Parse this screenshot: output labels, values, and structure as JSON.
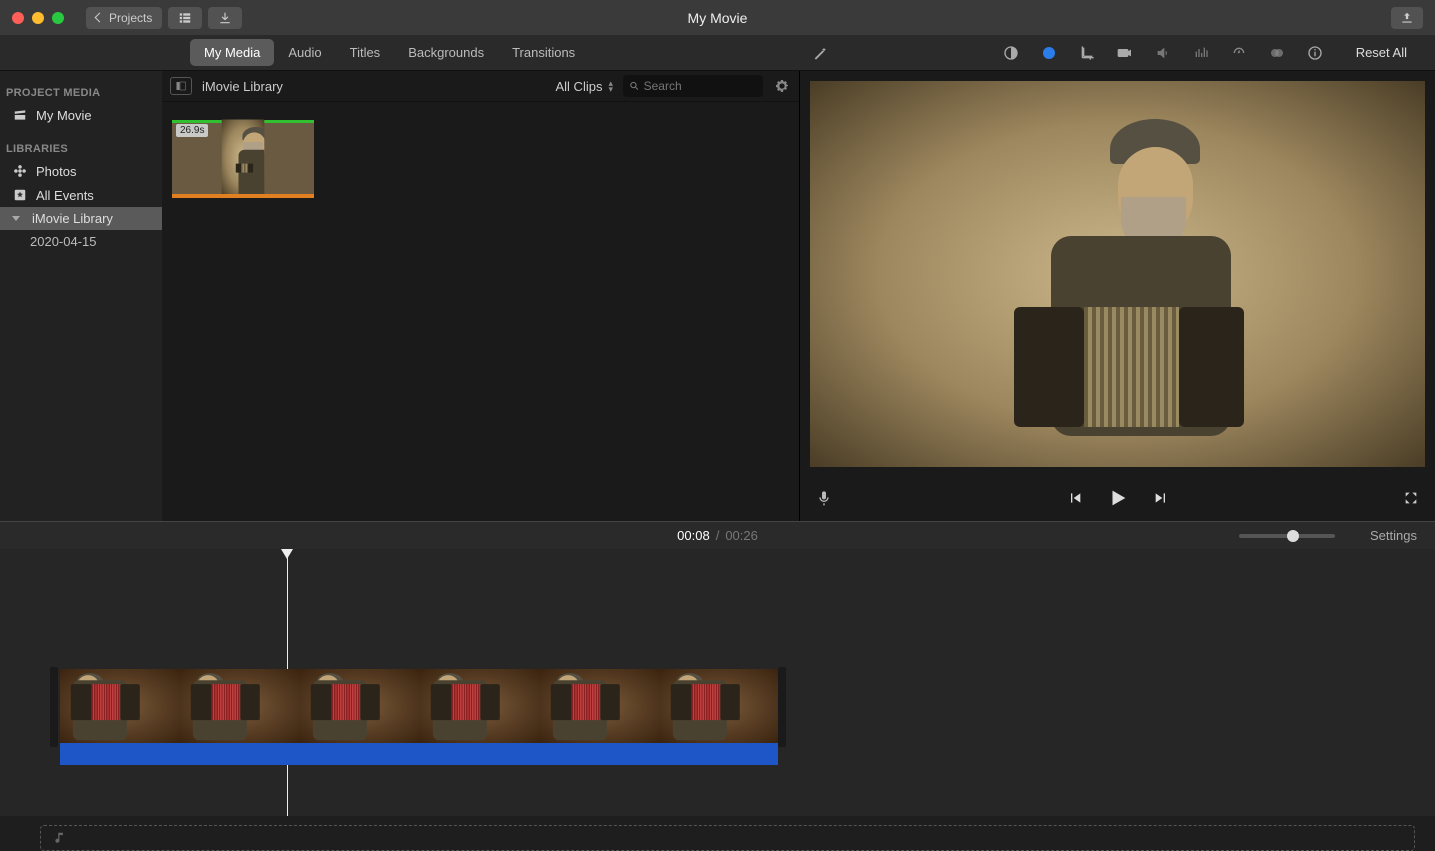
{
  "window": {
    "title": "My Movie"
  },
  "toolbar": {
    "back_label": "Projects"
  },
  "tabs": [
    "My Media",
    "Audio",
    "Titles",
    "Backgrounds",
    "Transitions"
  ],
  "active_tab_index": 0,
  "viewer_toolbar": {
    "reset_label": "Reset All"
  },
  "sidebar": {
    "headers": {
      "project": "PROJECT MEDIA",
      "libraries": "LIBRARIES"
    },
    "project_item": "My Movie",
    "photos": "Photos",
    "all_events": "All Events",
    "library": "iMovie Library",
    "event": "2020-04-15"
  },
  "browser": {
    "path": "iMovie Library",
    "clips_filter": "All Clips",
    "search_placeholder": "Search",
    "clip_duration": "26.9s"
  },
  "timecode": {
    "current": "00:08",
    "sep": "/",
    "total": "00:26"
  },
  "timeline": {
    "settings_label": "Settings"
  }
}
